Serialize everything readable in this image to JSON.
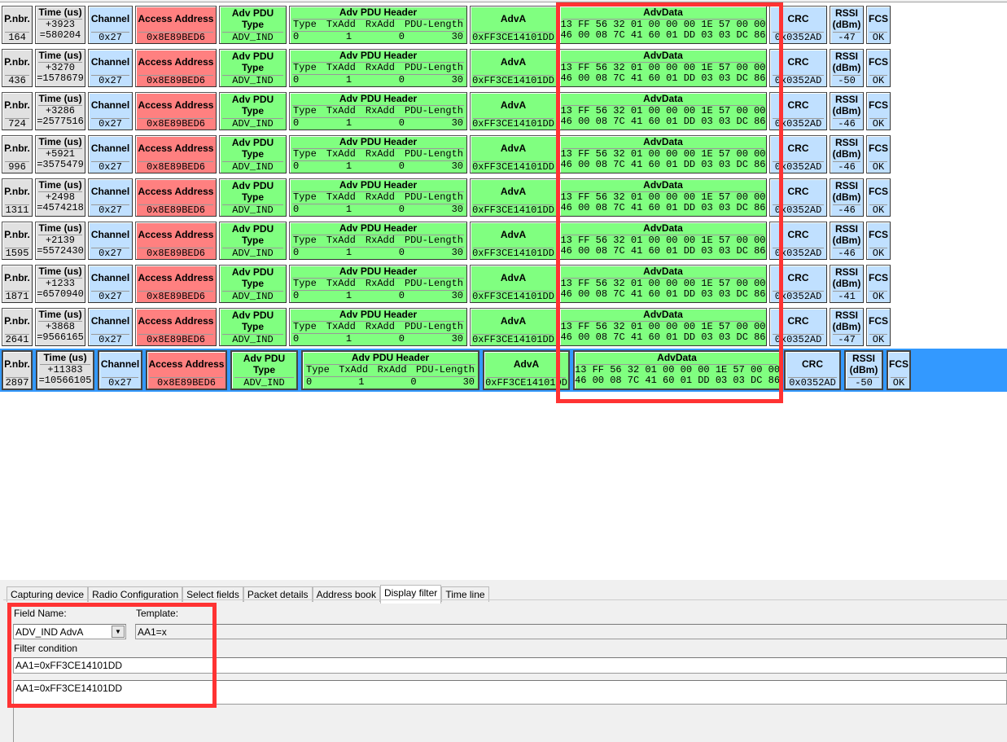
{
  "labels": {
    "pnbr": "P.nbr.",
    "time": "Time (us)",
    "channel": "Channel",
    "access": "Access Address",
    "pdutype": "Adv PDU Type",
    "header": "Adv PDU Header",
    "hdr_cols": [
      "Type",
      "TxAdd",
      "RxAdd",
      "PDU-Length"
    ],
    "adva": "AdvA",
    "advdata": "AdvData",
    "crc": "CRC",
    "rssi1": "RSSI",
    "rssi2": "(dBm)",
    "fcs": "FCS"
  },
  "packets": [
    {
      "pnbr": "164",
      "delta": "+3923",
      "abs": "=580204",
      "rssi": "-47"
    },
    {
      "pnbr": "436",
      "delta": "+3270",
      "abs": "=1578679",
      "rssi": "-50"
    },
    {
      "pnbr": "724",
      "delta": "+3286",
      "abs": "=2577516",
      "rssi": "-46"
    },
    {
      "pnbr": "996",
      "delta": "+5921",
      "abs": "=3575479",
      "rssi": "-46"
    },
    {
      "pnbr": "1311",
      "delta": "+2498",
      "abs": "=4574218",
      "rssi": "-46"
    },
    {
      "pnbr": "1595",
      "delta": "+2139",
      "abs": "=5572430",
      "rssi": "-46"
    },
    {
      "pnbr": "1871",
      "delta": "+1233",
      "abs": "=6570940",
      "rssi": "-41"
    },
    {
      "pnbr": "2641",
      "delta": "+3868",
      "abs": "=9566165",
      "rssi": "-47"
    },
    {
      "pnbr": "2897",
      "delta": "+11383",
      "abs": "=10566105",
      "rssi": "-50",
      "selected": true
    }
  ],
  "common": {
    "channel": "0x27",
    "access": "0x8E89BED6",
    "pdutype": "ADV_IND",
    "hdr_vals": [
      "0",
      "1",
      "0",
      "30"
    ],
    "adva": "0xFF3CE14101DD",
    "advdata1": "13 FF 56 32 01 00 00 00 1E 57 00 00",
    "advdata2": "46 00 08 7C 41 60 01 DD 03 03 DC 86",
    "crc": "0x0352AD",
    "fcs": "OK"
  },
  "tabs": [
    "Capturing device",
    "Radio Configuration",
    "Select fields",
    "Packet details",
    "Address book",
    "Display filter",
    "Time line"
  ],
  "active_tab": "Display filter",
  "filter": {
    "field_name_label": "Field Name:",
    "field_name_value": "ADV_IND AdvA",
    "template_label": "Template:",
    "template_value": "AA1=x",
    "condition_label": "Filter condition",
    "condition_value": "AA1=0xFF3CE14101DD",
    "applied_value": "AA1=0xFF3CE14101DD"
  },
  "colors": {
    "highlight": "#ff3333",
    "selection": "#3399ff",
    "gray": "#e1e1e1",
    "blue": "#c0e0ff",
    "red": "#ff8080",
    "green": "#80ff80"
  }
}
